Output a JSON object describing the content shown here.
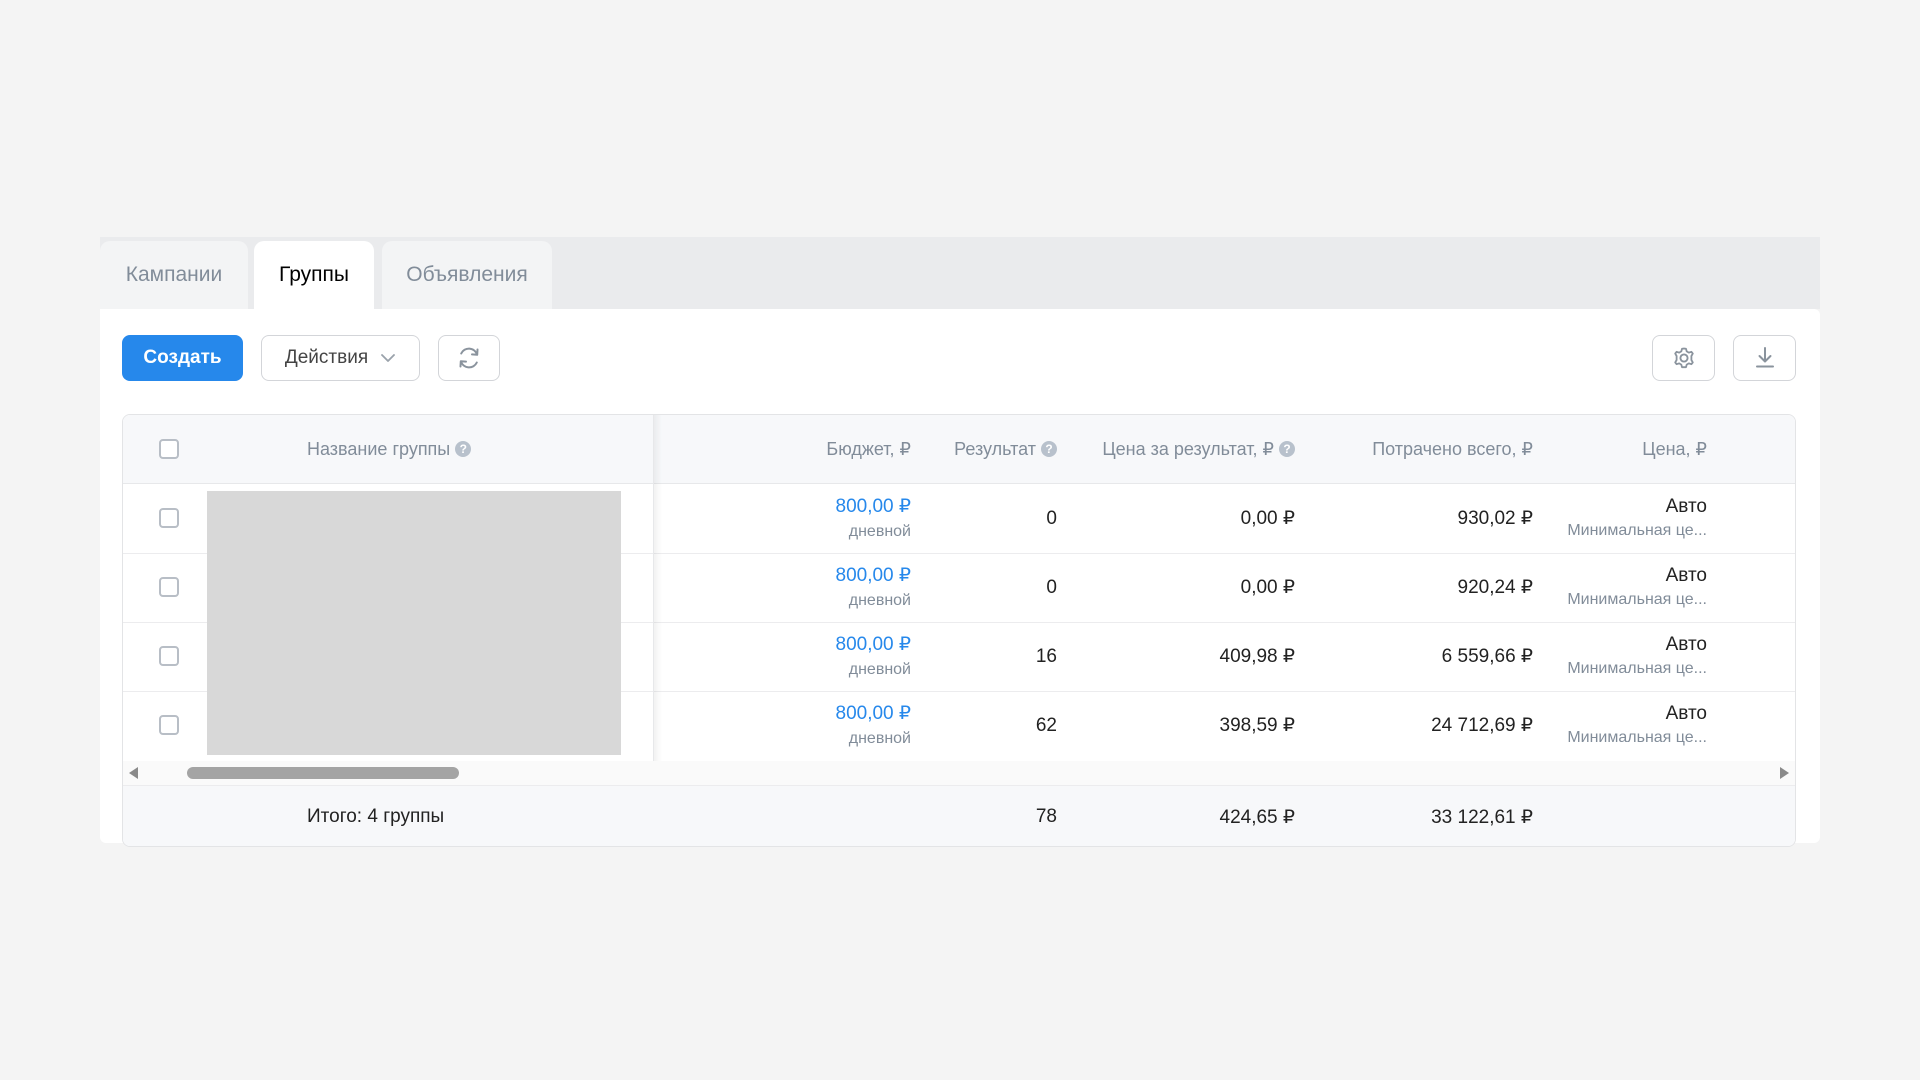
{
  "tabs": [
    {
      "label": "Кампании",
      "active": false
    },
    {
      "label": "Группы",
      "active": true
    },
    {
      "label": "Объявления",
      "active": false
    }
  ],
  "toolbar": {
    "create_label": "Создать",
    "actions_label": "Действия",
    "refresh_icon": "refresh-icon",
    "settings_icon": "gear-icon",
    "download_icon": "download-icon"
  },
  "table": {
    "columns": {
      "name": "Название группы",
      "budget": "Бюджет, ₽",
      "result": "Результат",
      "cost_per_result": "Цена за результат, ₽",
      "spent_total": "Потрачено всего, ₽",
      "price": "Цена, ₽"
    },
    "help_glyph": "?",
    "rows": [
      {
        "budget": "800,00 ₽",
        "budget_type": "дневной",
        "result": "0",
        "cost_per_result": "0,00 ₽",
        "spent_total": "930,02 ₽",
        "price": "Авто",
        "price_sub": "Минимальная це..."
      },
      {
        "budget": "800,00 ₽",
        "budget_type": "дневной",
        "result": "0",
        "cost_per_result": "0,00 ₽",
        "spent_total": "920,24 ₽",
        "price": "Авто",
        "price_sub": "Минимальная це..."
      },
      {
        "budget": "800,00 ₽",
        "budget_type": "дневной",
        "result": "16",
        "cost_per_result": "409,98 ₽",
        "spent_total": "6 559,66 ₽",
        "price": "Авто",
        "price_sub": "Минимальная це..."
      },
      {
        "budget": "800,00 ₽",
        "budget_type": "дневной",
        "result": "62",
        "cost_per_result": "398,59 ₽",
        "spent_total": "24 712,69 ₽",
        "price": "Авто",
        "price_sub": "Минимальная це..."
      }
    ],
    "footer": {
      "label": "Итого: 4 группы",
      "result": "78",
      "cost_per_result": "424,65 ₽",
      "spent_total": "33 122,61 ₽"
    }
  },
  "colors": {
    "accent": "#2688eb",
    "muted_text": "#818c99",
    "background": "#f4f4f4"
  }
}
